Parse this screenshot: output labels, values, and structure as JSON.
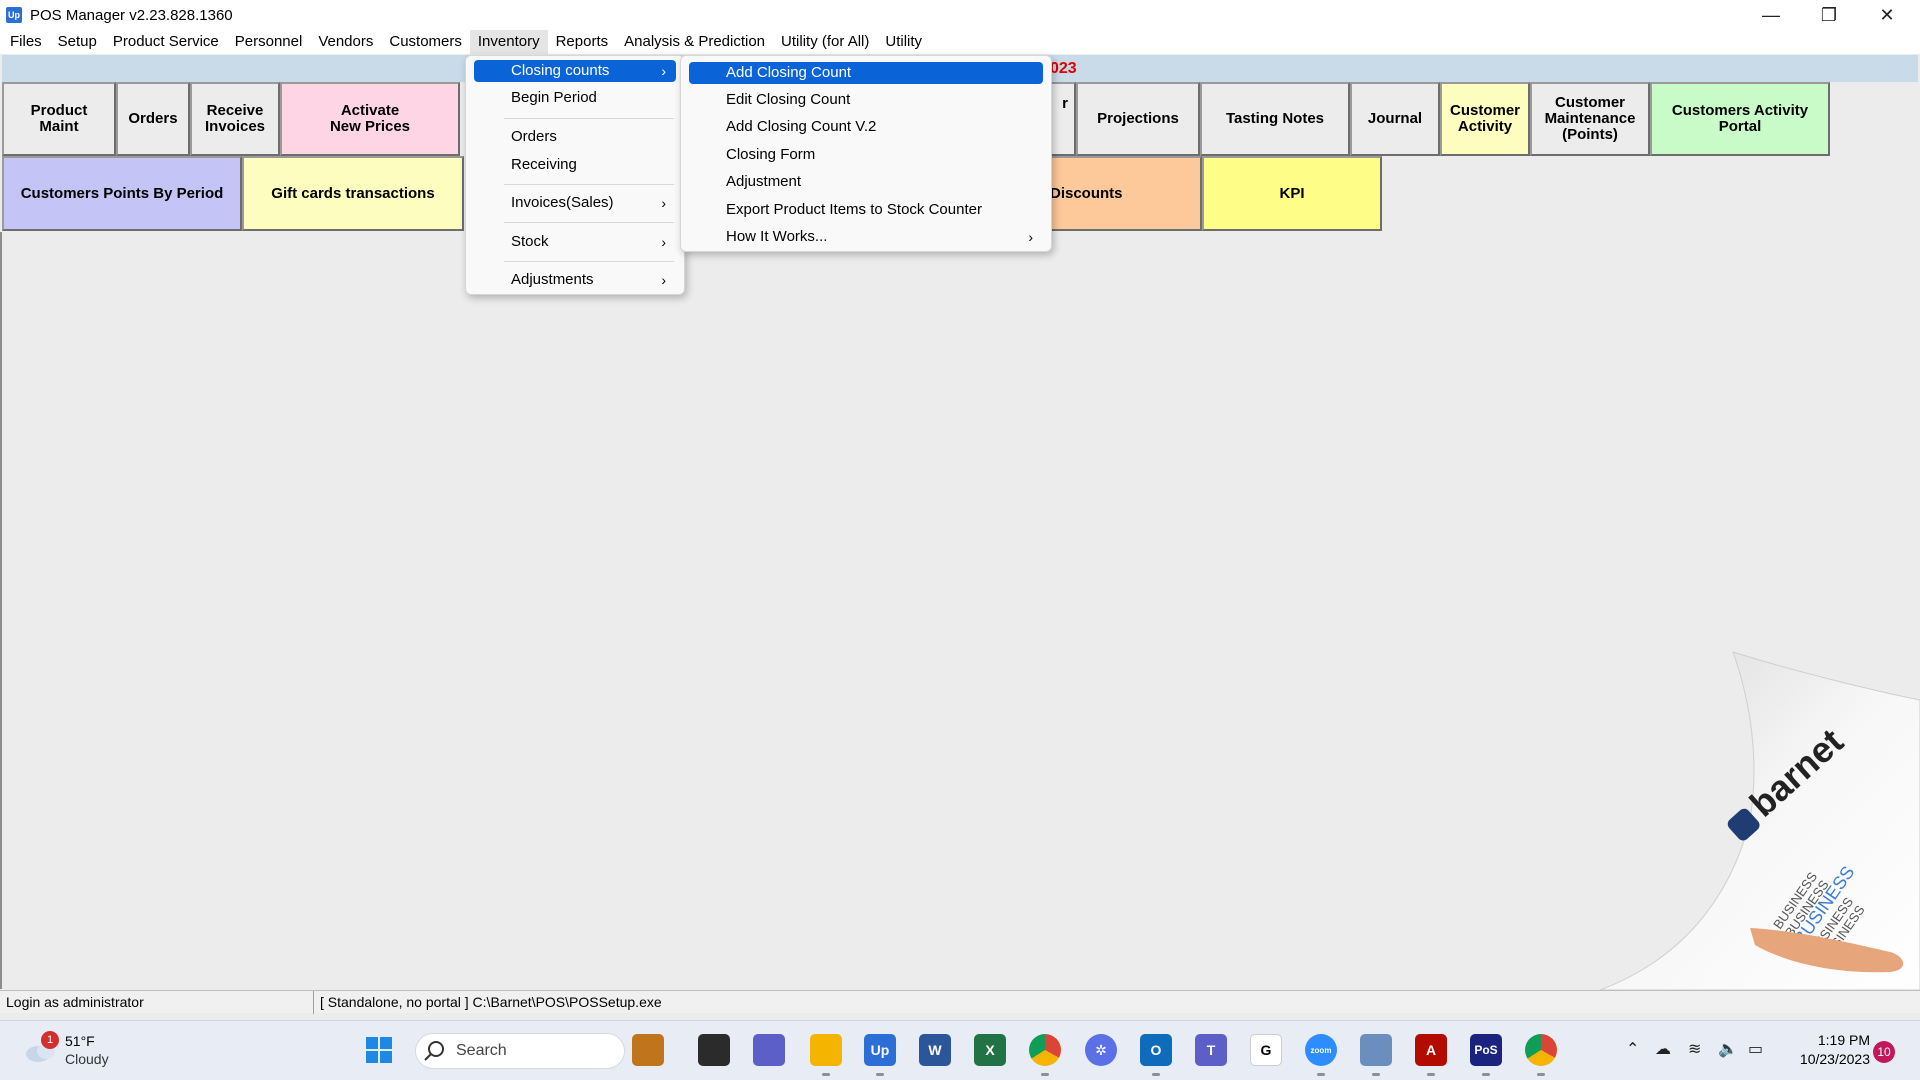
{
  "window": {
    "title": "POS Manager v2.23.828.1360",
    "app_icon_text": "Up",
    "minimize_icon": "—",
    "restore_icon": "❐",
    "close_icon": "✕"
  },
  "menubar": [
    "Files",
    "Setup",
    "Product Service",
    "Personnel",
    "Vendors",
    "Customers",
    "Inventory",
    "Reports",
    "Analysis & Prediction",
    "Utility (for All)",
    "Utility"
  ],
  "banner": {
    "text": "023"
  },
  "tiles_row1": [
    {
      "label": "Product\nMaint",
      "color": "#ececec"
    },
    {
      "label": "Orders",
      "color": "#ececec"
    },
    {
      "label": "Receive\nInvoices",
      "color": "#ececec"
    },
    {
      "label": "Activate\nNew Prices",
      "color": "#fdd5e5"
    },
    {
      "label": "r",
      "color": "#ececec"
    },
    {
      "label": "Projections",
      "color": "#ececec"
    },
    {
      "label": "Tasting Notes",
      "color": "#ececec"
    },
    {
      "label": "Journal",
      "color": "#ececec"
    },
    {
      "label": "Customer\nActivity",
      "color": "#fdfdc0"
    },
    {
      "label": "Customer\nMaintenance\n(Points)",
      "color": "#ececec"
    },
    {
      "label": "Customers Activity\nPortal",
      "color": "#c8fbc8"
    }
  ],
  "tiles_row2": [
    {
      "label": "Customers Points By Period",
      "color": "#c4c4f6"
    },
    {
      "label": "Gift cards transactions",
      "color": "#fdfdc0"
    },
    {
      "label": "Discounts",
      "color": "#fdc99a"
    },
    {
      "label": "KPI",
      "color": "#fdfd88"
    }
  ],
  "inventory_menu": [
    {
      "label": "Closing  counts",
      "arrow": "›"
    },
    {
      "label": "Begin Period",
      "arrow": ""
    },
    {
      "label": "Orders",
      "arrow": ""
    },
    {
      "label": "Receiving",
      "arrow": ""
    },
    {
      "label": "Invoices(Sales)",
      "arrow": "›"
    },
    {
      "label": "Stock",
      "arrow": "›"
    },
    {
      "label": "Adjustments",
      "arrow": "›"
    }
  ],
  "closing_submenu": [
    {
      "label": "Add Closing Count",
      "arrow": ""
    },
    {
      "label": "Edit Closing Count",
      "arrow": ""
    },
    {
      "label": "Add Closing Count  V.2",
      "arrow": ""
    },
    {
      "label": "Closing Form",
      "arrow": ""
    },
    {
      "label": "Adjustment",
      "arrow": ""
    },
    {
      "label": "Export Product Items to Stock Counter",
      "arrow": ""
    },
    {
      "label": "How It Works...",
      "arrow": "›"
    }
  ],
  "status": {
    "login": "Login as administrator",
    "mode": "[ Standalone, no portal ]   C:\\Barnet\\POS\\POSSetup.exe"
  },
  "logo": {
    "brand": "barnet",
    "tagline": "BUSINESS"
  },
  "taskbar": {
    "weather_temp": "51°F",
    "weather_desc": "Cloudy",
    "weather_badge": "1",
    "search_label": "Search",
    "time": "1:19 PM",
    "date": "10/23/2023",
    "notifications": "10",
    "apps": [
      {
        "name": "start",
        "glyph": "",
        "color": "#1e88e5"
      },
      {
        "name": "work",
        "glyph": "",
        "color": "#b5651d"
      },
      {
        "name": "task-view",
        "glyph": "",
        "color": "#2b2b2b"
      },
      {
        "name": "meet",
        "glyph": "",
        "color": "#5b5fc7"
      },
      {
        "name": "explorer",
        "glyph": "",
        "color": "#f4b400"
      },
      {
        "name": "up",
        "glyph": "Up",
        "color": "#2b6fd6"
      },
      {
        "name": "word",
        "glyph": "W",
        "color": "#2b579a"
      },
      {
        "name": "excel",
        "glyph": "X",
        "color": "#217346"
      },
      {
        "name": "chrome",
        "glyph": "",
        "color": "#db4437"
      },
      {
        "name": "settings",
        "glyph": "✲",
        "color": "#5b6fe6"
      },
      {
        "name": "outlook",
        "glyph": "O",
        "color": "#0f6cbd"
      },
      {
        "name": "teams",
        "glyph": "T",
        "color": "#5b5fc7"
      },
      {
        "name": "g-app",
        "glyph": "G",
        "color": "#ffffff"
      },
      {
        "name": "zoom",
        "glyph": "zoom",
        "color": "#2d8cff"
      },
      {
        "name": "monitor",
        "glyph": "",
        "color": "#6c8ebf"
      },
      {
        "name": "acrobat",
        "glyph": "A",
        "color": "#b30b00"
      },
      {
        "name": "pos",
        "glyph": "PoS",
        "color": "#1a237e"
      },
      {
        "name": "chrome-up",
        "glyph": "",
        "color": "#db4437"
      }
    ]
  }
}
